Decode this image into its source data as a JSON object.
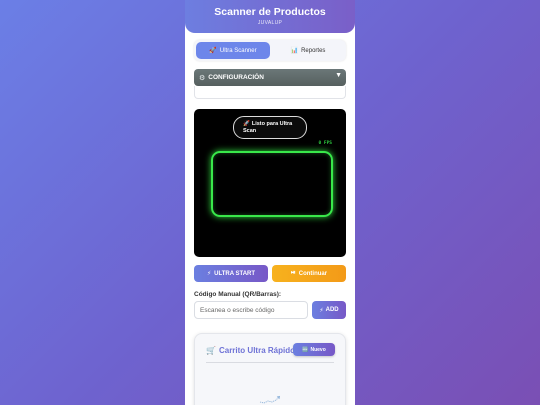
{
  "header": {
    "title": "Scanner de Productos",
    "subtitle": "JUVALUP"
  },
  "tabs": [
    {
      "label": "Ultra Scanner",
      "icon": "rocket-icon",
      "active": true
    },
    {
      "label": "Reportes",
      "icon": "chart-icon",
      "active": false
    }
  ],
  "config": {
    "label": "CONFIGURACIÓN",
    "icon": "gear-icon",
    "expanded_icon": "triangle-down-icon"
  },
  "scanner": {
    "status": "Listo para Ultra Scan",
    "status_icon": "rocket-icon",
    "fps": "0 FPS",
    "frame_color": "#39e84a"
  },
  "actions": {
    "start_label": "ULTRA START",
    "start_icon": "lightning-icon",
    "continue_label": "Continuar",
    "continue_icon": "play-icon"
  },
  "manual": {
    "label": "Código Manual (QR/Barras):",
    "placeholder": "Escanea o escribe código",
    "add_label": "ADD",
    "add_icon": "lightning-icon"
  },
  "cart": {
    "title": "Carrito Ultra Rápido",
    "title_icon": "cart-icon",
    "new_label": "Nuevo",
    "new_icon": "new-icon"
  },
  "colors": {
    "accent": "#6d86ea",
    "purple": "#7758c7",
    "orange": "#f7b21e",
    "scan_green": "#39e84a"
  }
}
